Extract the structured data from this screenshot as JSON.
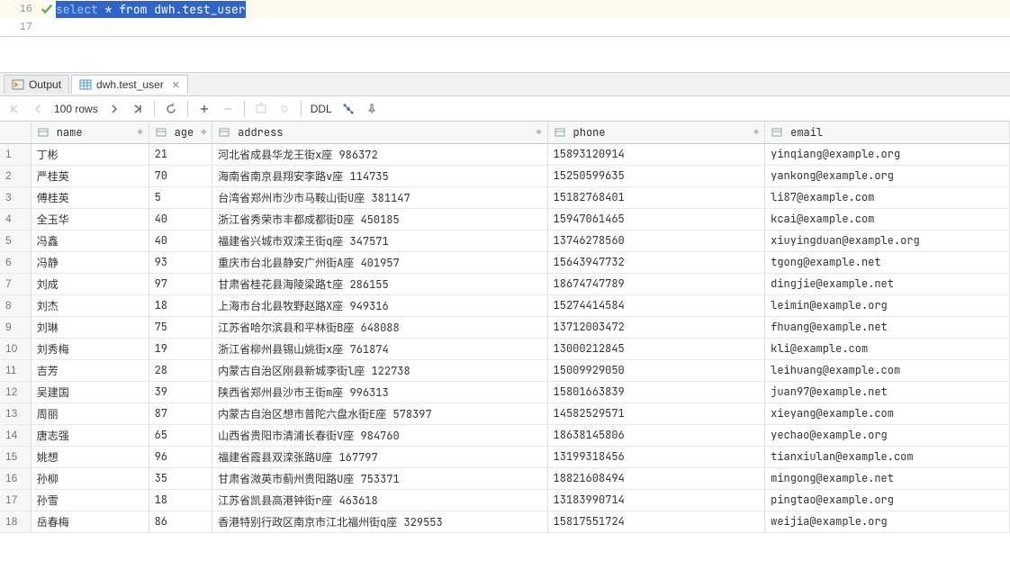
{
  "editor": {
    "line_no_1": "16",
    "line_no_2": "17",
    "sql_kw": "select",
    "sql_rest": " * from dwh.test_user"
  },
  "tabs": {
    "output": "Output",
    "result": "dwh.test_user"
  },
  "toolbar": {
    "rows": "100 rows",
    "ddl": "DDL"
  },
  "columns": {
    "name": "name",
    "age": "age",
    "address": "address",
    "phone": "phone",
    "email": "email"
  },
  "rows": [
    {
      "n": "1",
      "name": "丁彬",
      "age": "21",
      "address": "河北省成县华龙王街x座 986372",
      "phone": "15893120914",
      "email": "yinqiang@example.org"
    },
    {
      "n": "2",
      "name": "严桂英",
      "age": "70",
      "address": "海南省南京县翔安李路v座 114735",
      "phone": "15250599635",
      "email": "yankong@example.org"
    },
    {
      "n": "3",
      "name": "傅桂英",
      "age": "5",
      "address": "台湾省郑州市沙市马鞍山街U座 381147",
      "phone": "15182768401",
      "email": "li87@example.com"
    },
    {
      "n": "4",
      "name": "全玉华",
      "age": "40",
      "address": "浙江省秀荣市丰都成都街D座 450185",
      "phone": "15947061465",
      "email": "kcai@example.com"
    },
    {
      "n": "5",
      "name": "冯鑫",
      "age": "40",
      "address": "福建省兴城市双滦王街q座 347571",
      "phone": "13746278560",
      "email": "xiuyingduan@example.org"
    },
    {
      "n": "6",
      "name": "冯静",
      "age": "93",
      "address": "重庆市台北县静安广州街A座 401957",
      "phone": "15643947732",
      "email": "tgong@example.net"
    },
    {
      "n": "7",
      "name": "刘成",
      "age": "97",
      "address": "甘肃省桂花县海陵梁路t座 286155",
      "phone": "18674747789",
      "email": "dingjie@example.net"
    },
    {
      "n": "8",
      "name": "刘杰",
      "age": "18",
      "address": "上海市台北县牧野赵路X座 949316",
      "phone": "15274414584",
      "email": "leimin@example.org"
    },
    {
      "n": "9",
      "name": "刘琳",
      "age": "75",
      "address": "江苏省哈尔滨县和平林街B座 648088",
      "phone": "13712003472",
      "email": "fhuang@example.net"
    },
    {
      "n": "10",
      "name": "刘秀梅",
      "age": "19",
      "address": "浙江省柳州县锡山姚街x座 761874",
      "phone": "13000212845",
      "email": "kli@example.com"
    },
    {
      "n": "11",
      "name": "吉芳",
      "age": "28",
      "address": "内蒙古自治区刚县新城李街l座 122738",
      "phone": "15009929050",
      "email": "leihuang@example.com"
    },
    {
      "n": "12",
      "name": "吴建国",
      "age": "39",
      "address": "陕西省郑州县沙市王街m座 996313",
      "phone": "15801663839",
      "email": "juan97@example.net"
    },
    {
      "n": "13",
      "name": "周丽",
      "age": "87",
      "address": "内蒙古自治区想市普陀六盘水街E座 578397",
      "phone": "14582529571",
      "email": "xieyang@example.com"
    },
    {
      "n": "14",
      "name": "唐志强",
      "age": "65",
      "address": "山西省贵阳市清浦长春街V座 984760",
      "phone": "18638145806",
      "email": "yechao@example.org"
    },
    {
      "n": "15",
      "name": "姚想",
      "age": "96",
      "address": "福建省霞县双滦张路U座 167797",
      "phone": "13199318456",
      "email": "tianxiulan@example.com"
    },
    {
      "n": "16",
      "name": "孙柳",
      "age": "35",
      "address": "甘肃省溦英市蓟州贵阳路U座 753371",
      "phone": "18821608494",
      "email": "mingong@example.net"
    },
    {
      "n": "17",
      "name": "孙雪",
      "age": "18",
      "address": "江苏省凯县高港钟街r座 463618",
      "phone": "13183990714",
      "email": "pingtao@example.org"
    },
    {
      "n": "18",
      "name": "岳春梅",
      "age": "86",
      "address": "香港特别行政区南京市江北福州街q座 329553",
      "phone": "15817551724",
      "email": "weijia@example.org"
    }
  ]
}
